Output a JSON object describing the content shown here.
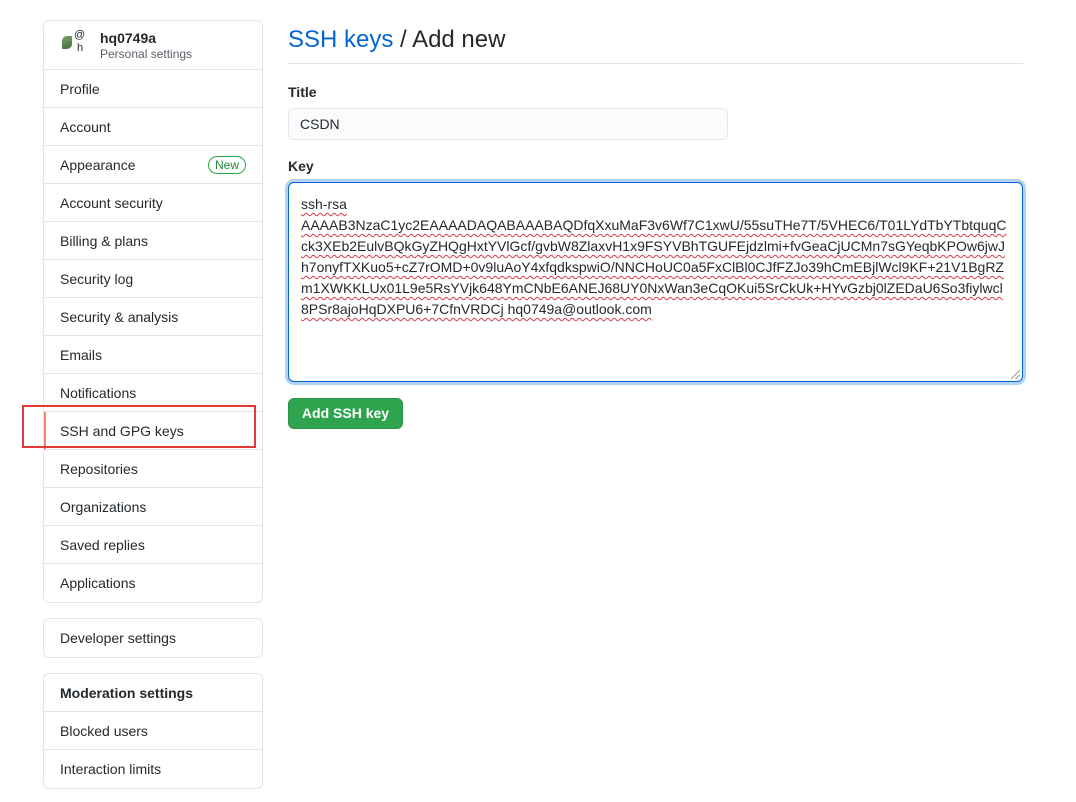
{
  "sidebar": {
    "user": {
      "avatar_alt": "@",
      "avatar_alt_2": "h",
      "avatar_alt_3": "_",
      "username": "hq0749a",
      "subtitle": "Personal settings"
    },
    "items": [
      {
        "label": "Profile"
      },
      {
        "label": "Account"
      },
      {
        "label": "Appearance",
        "badge": "New"
      },
      {
        "label": "Account security"
      },
      {
        "label": "Billing & plans"
      },
      {
        "label": "Security log"
      },
      {
        "label": "Security & analysis"
      },
      {
        "label": "Emails"
      },
      {
        "label": "Notifications"
      },
      {
        "label": "SSH and GPG keys",
        "selected": true
      },
      {
        "label": "Repositories"
      },
      {
        "label": "Organizations"
      },
      {
        "label": "Saved replies"
      },
      {
        "label": "Applications"
      }
    ],
    "developer": {
      "label": "Developer settings"
    },
    "moderation": {
      "heading": "Moderation settings",
      "items": [
        {
          "label": "Blocked users"
        },
        {
          "label": "Interaction limits"
        }
      ]
    }
  },
  "header": {
    "crumb_link": "SSH keys",
    "separator": "/",
    "current": "Add new"
  },
  "form": {
    "title_label": "Title",
    "title_value": "CSDN",
    "key_label": "Key",
    "key_line1": "ssh-rsa",
    "key_body": "AAAAB3NzaC1yc2EAAAADAQABAAABAQDfqXxuMaF3v6Wf7C1xwU/55suTHe7T/5VHEC6/T01LYdTbYTbtquqCck3XEb2EulvBQkGyZHQgHxtYVlGcf/gvbW8ZlaxvH1x9FSYVBhTGUFEjdzlmi+fvGeaCjUCMn7sGYeqbKPOw6jwJh7onyfTXKuo5+cZ7rOMD+0v9luAoY4xfqdkspwiO/NNCHoUC0a5FxClBl0CJfFZJo39hCmEBjlWcl9KF+21V1BgRZm1XWKKLUx01L9e5RsYVjk648YmCNbE6ANEJ68UY0NxWan3eCqOKui5SrCkUk+HYvGzbj0lZEDaU6So3fiylwcl8PSr8ajoHqDXPU6+7CfnVRDCj hq0749a@outlook.com",
    "submit_label": "Add SSH key"
  },
  "colors": {
    "link": "#0366d6",
    "primary_button": "#2ea44f",
    "selected_indicator": "#f9826c",
    "highlight_annotation": "#e53935",
    "badge_green": "#28a745"
  }
}
